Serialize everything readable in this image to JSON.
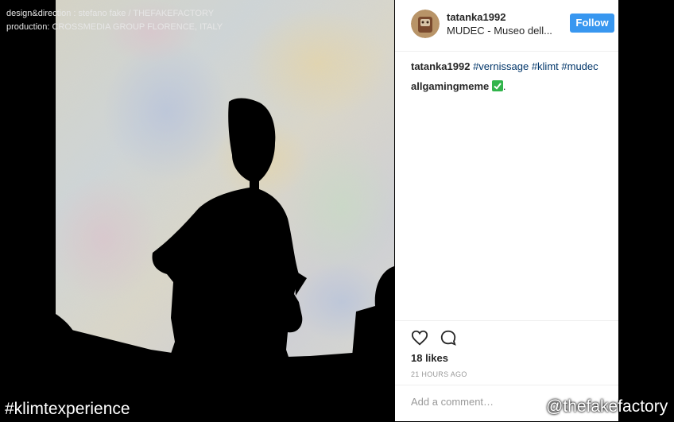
{
  "credits": {
    "line1": "design&direction : stefano fake / THEFAKEFACTORY",
    "line2": "production: CROSSMEDIA GROUP FLORENCE, ITALY"
  },
  "post": {
    "username": "tatanka1992",
    "location": "MUDEC - Museo dell...",
    "follow_label": "Follow",
    "caption": {
      "username": "tatanka1992",
      "hashtags": [
        "#vernissage",
        "#klimt",
        "#mudec"
      ]
    },
    "comment": {
      "username": "allgamingmeme",
      "emoji": "check-mark-emoji"
    },
    "likes": "18 likes",
    "timestamp": "21 HOURS AGO",
    "comment_placeholder": "Add a comment…"
  },
  "overlay": {
    "hashtag": "#klimtexperience",
    "handle": "@thefakefactory"
  },
  "colors": {
    "follow_bg": "#3897f0",
    "hashtag_link": "#003569",
    "check_emoji": "#31b44b"
  },
  "icons": [
    "heart-icon",
    "comment-icon"
  ]
}
